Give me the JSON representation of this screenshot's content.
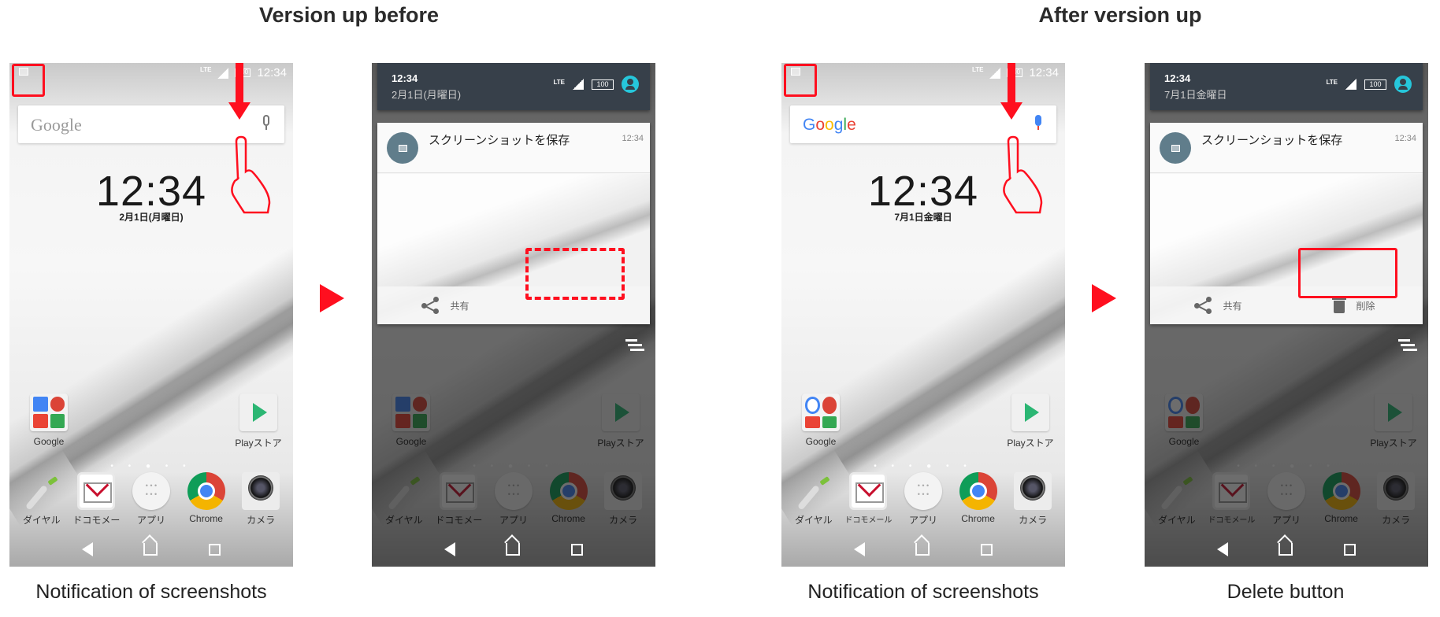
{
  "sections": [
    {
      "title": "Version up before"
    },
    {
      "title": "After version up"
    }
  ],
  "captions": [
    "Notification of screenshots",
    "Notification of screenshots",
    "Delete button"
  ],
  "colors": {
    "highlight_red": "#ff0f1f",
    "shade_header": "#37404a",
    "avatar_cyan": "#26c6da",
    "notif_icon_bg": "#607d8b"
  },
  "phones": [
    {
      "status": {
        "lte": "LTE",
        "time": "12:34",
        "battery": "100"
      },
      "search": {
        "logo": "Google"
      },
      "clock": {
        "time": "12:34",
        "date": "2月1日(月曜日)"
      },
      "home_icons": {
        "folder": "Google",
        "play": "Playストア"
      },
      "dock": [
        "ダイヤル",
        "ドコモメー",
        "アプリ",
        "Chrome",
        "カメラ"
      ]
    },
    {
      "shade": {
        "time": "12:34",
        "date": "2月1日(月曜日)",
        "lte": "LTE",
        "battery": "100"
      },
      "notification": {
        "title": "スクリーンショットを保存",
        "time": "12:34",
        "actions": [
          "共有"
        ]
      },
      "home_icons": {
        "folder": "Google",
        "play": "Playストア"
      },
      "dock": [
        "ダイヤル",
        "ドコモメー",
        "アプリ",
        "Chrome",
        "カメラ"
      ]
    },
    {
      "status": {
        "lte": "LTE",
        "time": "12:34",
        "battery": "100"
      },
      "search": {
        "logo": "Google"
      },
      "clock": {
        "time": "12:34",
        "date": "7月1日金曜日"
      },
      "home_icons": {
        "folder": "Google",
        "play": "Playストア"
      },
      "dock": [
        "ダイヤル",
        "ドコモメール",
        "アプリ",
        "Chrome",
        "カメラ"
      ]
    },
    {
      "shade": {
        "time": "12:34",
        "date": "7月1日金曜日",
        "lte": "LTE",
        "battery": "100"
      },
      "notification": {
        "title": "スクリーンショットを保存",
        "time": "12:34",
        "actions": [
          "共有",
          "削除"
        ]
      },
      "home_icons": {
        "folder": "Google",
        "play": "Playストア"
      },
      "dock": [
        "ダイヤル",
        "ドコモメール",
        "アプリ",
        "Chrome",
        "カメラ"
      ]
    }
  ]
}
